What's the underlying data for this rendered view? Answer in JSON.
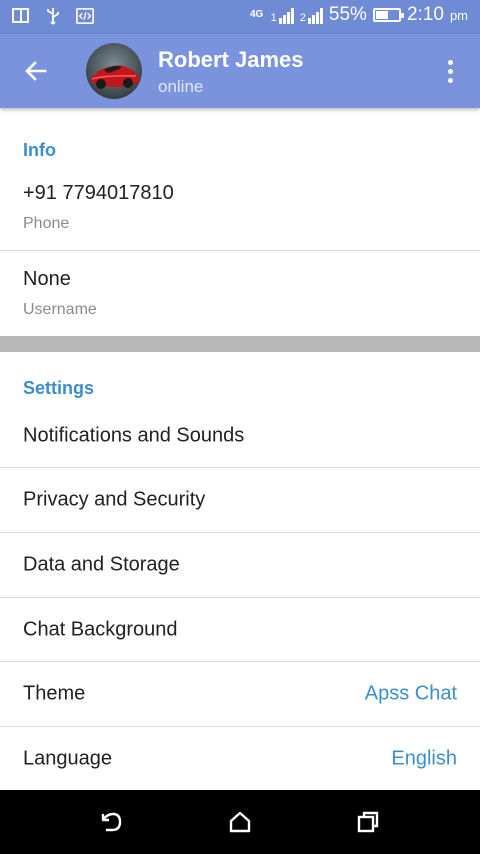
{
  "status_bar": {
    "network": "4G",
    "sim1": "1",
    "sim2": "2",
    "battery": "55%",
    "battery_level": 0.55,
    "time": "2:10",
    "ampm": "pm"
  },
  "header": {
    "contact_name": "Robert James",
    "status": "online"
  },
  "info": {
    "section_title": "Info",
    "phone_value": "+91 7794017810",
    "phone_label": "Phone",
    "username_value": "None",
    "username_label": "Username"
  },
  "settings": {
    "section_title": "Settings",
    "items": [
      {
        "label": "Notifications and Sounds",
        "value": ""
      },
      {
        "label": "Privacy and Security",
        "value": ""
      },
      {
        "label": "Data and Storage",
        "value": ""
      },
      {
        "label": "Chat Background",
        "value": ""
      },
      {
        "label": "Theme",
        "value": "Apss Chat"
      },
      {
        "label": "Language",
        "value": "English"
      }
    ]
  },
  "colors": {
    "app_bar": "#7b93dd",
    "status_bar": "#6f8bd6",
    "accent": "#3a8ed0"
  }
}
